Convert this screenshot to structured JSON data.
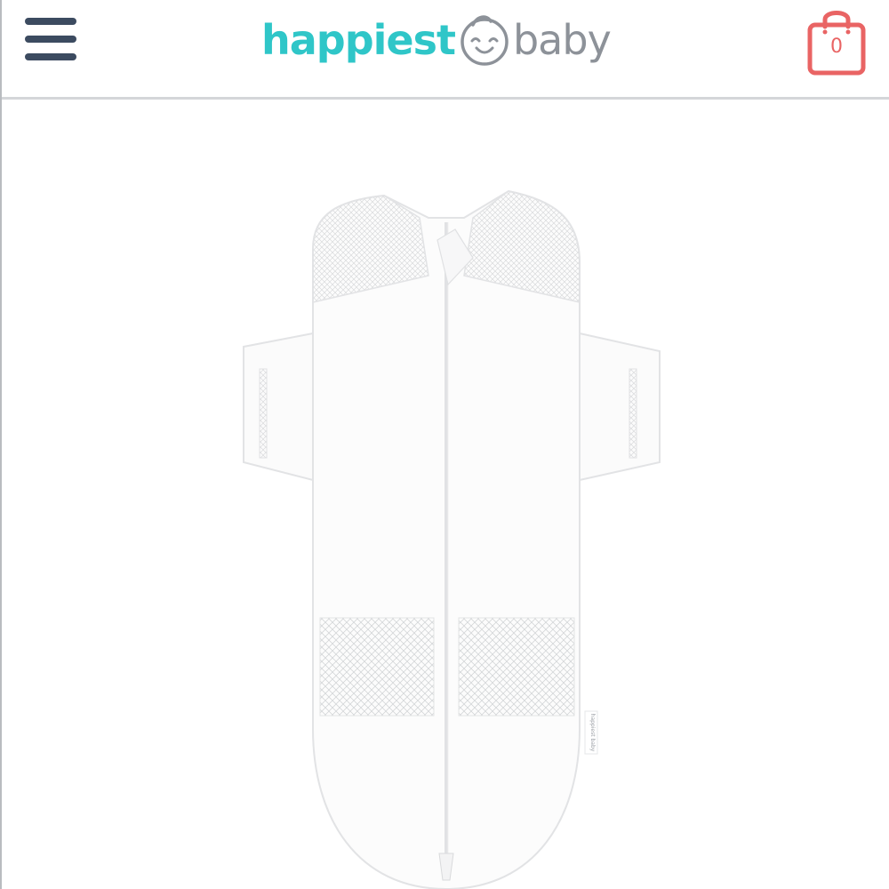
{
  "header": {
    "logo": {
      "part1": "happiest",
      "part2": "baby",
      "brand_color_primary": "#2fc6c8",
      "brand_color_secondary": "#8d9299",
      "face_icon": "smiling-baby-face-icon"
    },
    "menu_icon": "hamburger-menu-icon",
    "cart": {
      "icon": "shopping-bag-icon",
      "count": "0",
      "color": "#e96464"
    }
  },
  "product": {
    "image_icon": "white-sleep-sack-swaddle",
    "label_text": "happiest baby"
  },
  "colors": {
    "menu": "#3c4b60",
    "divider": "#d4d6d9",
    "background": "#ffffff"
  }
}
